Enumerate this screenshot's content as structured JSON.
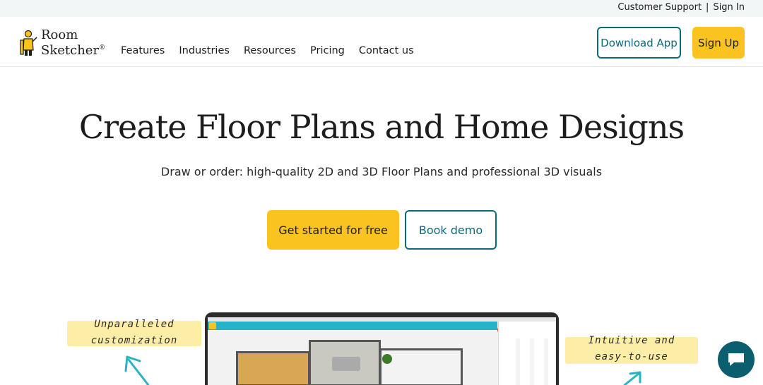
{
  "topbar": {
    "support_label": "Customer Support",
    "separator": "|",
    "signin_label": "Sign In"
  },
  "header": {
    "logo_line1": "Room",
    "logo_line2": "Sketcher",
    "logo_reg": "®",
    "nav": [
      {
        "label": "Features"
      },
      {
        "label": "Industries"
      },
      {
        "label": "Resources"
      },
      {
        "label": "Pricing"
      },
      {
        "label": "Contact us"
      }
    ],
    "download_label": "Download App",
    "signup_label": "Sign Up"
  },
  "hero": {
    "title": "Create Floor Plans and Home Designs",
    "subtitle": "Draw or order: high-quality 2D and 3D Floor Plans and professional 3D visuals",
    "primary_cta": "Get started for free",
    "secondary_cta": "Book demo"
  },
  "annotations": {
    "left_line1": "Unparalleled",
    "left_line2": "customization",
    "right_line1": "Intuitive and",
    "right_line2": "easy-to-use"
  },
  "colors": {
    "accent_yellow": "#fbc31f",
    "brand_teal": "#0b6a78",
    "chat_teal": "#0b5e6e",
    "app_toolbar": "#26b3c9"
  },
  "icons": {
    "logo": "roomsketcher-logo-icon",
    "chat": "chat-bubble-icon",
    "arrow_left": "arrow-up-left-icon",
    "arrow_right": "arrow-up-right-icon"
  }
}
